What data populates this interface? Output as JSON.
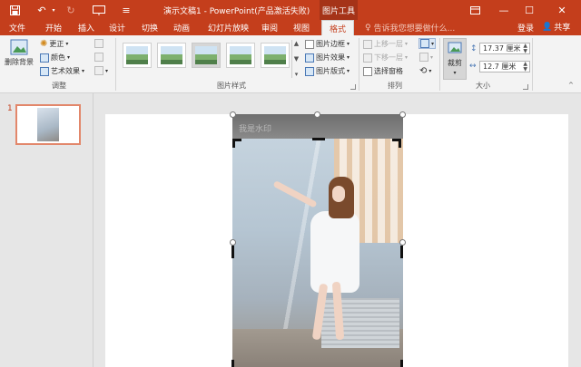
{
  "app": {
    "title": "演示文稿1 - PowerPoint(产品激活失败)",
    "context_tab_header": "图片工具"
  },
  "quick_access": {
    "save_icon": "save-icon",
    "undo_icon": "undo-icon",
    "redo_icon": "redo-icon",
    "slideshow_icon": "start-from-beginning-icon"
  },
  "window_controls": {
    "ribbon_display_icon": "ribbon-display-options-icon",
    "minimize": "—",
    "maximize": "☐",
    "close": "✕"
  },
  "tabs": [
    {
      "label": "文件"
    },
    {
      "label": "开始"
    },
    {
      "label": "插入"
    },
    {
      "label": "设计"
    },
    {
      "label": "切换"
    },
    {
      "label": "动画"
    },
    {
      "label": "幻灯片放映"
    },
    {
      "label": "审阅"
    },
    {
      "label": "视图"
    },
    {
      "label": "格式"
    }
  ],
  "tell_me": "告诉我您想要做什么...",
  "account": {
    "signin": "登录",
    "share": "共享"
  },
  "ribbon": {
    "adjust": {
      "remove_bg": "删除背景",
      "corrections": "更正",
      "color": "颜色",
      "artistic": "艺术效果",
      "label": "调整"
    },
    "picture_styles": {
      "border": "图片边框",
      "effects": "图片效果",
      "layout": "图片版式",
      "label": "图片样式"
    },
    "arrange": {
      "bring_forward": "上移一层",
      "send_backward": "下移一层",
      "selection_pane": "选择窗格",
      "label": "排列"
    },
    "size": {
      "crop": "裁剪",
      "height": "17.37 厘米",
      "width": "12.7 厘米",
      "label": "大小"
    }
  },
  "slides": [
    {
      "number": "1"
    }
  ],
  "slide": {
    "watermark_text": "我是水印"
  },
  "colors": {
    "accent": "#c43e1c",
    "context_tab": "#a53318",
    "ribbon_bg": "#f3f3f3"
  }
}
